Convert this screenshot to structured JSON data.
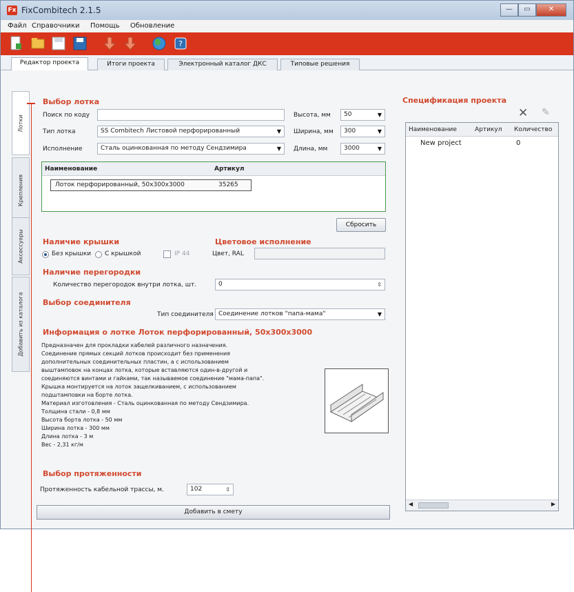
{
  "window": {
    "title": "FixCombitech 2.1.5",
    "app_icon": "fixcombitech-logo",
    "buttons": {
      "minimize": "—",
      "maximize": "▭",
      "close": "✕"
    }
  },
  "menu": [
    "Файл",
    "Справочники",
    "Помощь",
    "Обновление"
  ],
  "toolbar_icons": [
    "new-document-icon",
    "open-folder-icon",
    "save-icon",
    "save-as-icon",
    "import-icon",
    "export-icon",
    "globe-icon",
    "help-icon"
  ],
  "tabs": [
    "Редактор проекта",
    "Итоги проекта",
    "Электронный каталог ДКС",
    "Типовые решения"
  ],
  "side_tabs": [
    "Лотки",
    "Крепления",
    "Аксессуары",
    "Добавить из каталога"
  ],
  "tray": {
    "section": "Выбор лотка",
    "search_label": "Поиск по коду",
    "search_value": "",
    "type_label": "Тип лотка",
    "type_value": "SS Combitech Листовой перфорированный",
    "finish_label": "Исполнение",
    "finish_value": "Сталь оцинкованная по методу Сендзимира",
    "height_label": "Высота, мм",
    "height_value": "50",
    "width_label": "Ширина, мм",
    "width_value": "300",
    "length_label": "Длина, мм",
    "length_value": "3000",
    "columns": [
      "Наименование",
      "Артикул"
    ],
    "row_name": "Лоток перфорированный, 50х300х3000",
    "row_code": "35265",
    "reset_label": "Сбросить"
  },
  "cover": {
    "section": "Наличие крышки",
    "no_cover": "Без крышки",
    "with_cover": "С крышкой",
    "ip_label": "IP 44"
  },
  "color": {
    "section": "Цветовое исполнение",
    "label": "Цвет, RAL",
    "value": ""
  },
  "partitions": {
    "section": "Наличие перегородки",
    "label": "Количество перегородок внутри лотка, шт.",
    "value": "0"
  },
  "connector": {
    "section": "Выбор соединителя",
    "label": "Тип соединителя",
    "value": "Соединение лотков \"папа-мама\""
  },
  "info": {
    "title": "Информация о лотке Лоток перфорированный, 50х300х3000",
    "lines": [
      "Предназначен для прокладки кабелей различного назначения.",
      "Соединение прямых секций лотков происходит без применения",
      "дополнительных соединительных пластин, а с использованием",
      "выштамповок на концах лотка, которые вставляются один-в-другой и",
      "соединяются винтами и гайками, так называемое соединение \"мама-папа\".",
      "Крышка монтируется на лоток защелкиванием, с использованием",
      "подштамповки на борте лотка.",
      "Материал изготовления - Сталь оцинкованная по методу Сендзимира.",
      "Толщина стали - 0,8 мм",
      "Высота борта лотка - 50 мм",
      "Ширина лотка - 300 мм",
      "Длина лотка - 3 м",
      "Вес - 2,31 кг/м"
    ]
  },
  "length": {
    "section": "Выбор протяженности",
    "label": "Протяженность кабельной трассы, м.",
    "value": "102"
  },
  "add_button": "Добавить в смету",
  "spec": {
    "title": "Спецификация проекта",
    "columns": [
      "Наименование",
      "Артикул",
      "Количество"
    ],
    "rows": [
      {
        "name": "New project",
        "code": "",
        "qty": "0"
      }
    ],
    "delete_icon": "✕",
    "edit_icon": "✎"
  },
  "colors": {
    "accent": "#d9351c",
    "heading": "#d14a2f",
    "titlebar": "#c4d4e8",
    "grid_border": "#4a9a4a"
  }
}
